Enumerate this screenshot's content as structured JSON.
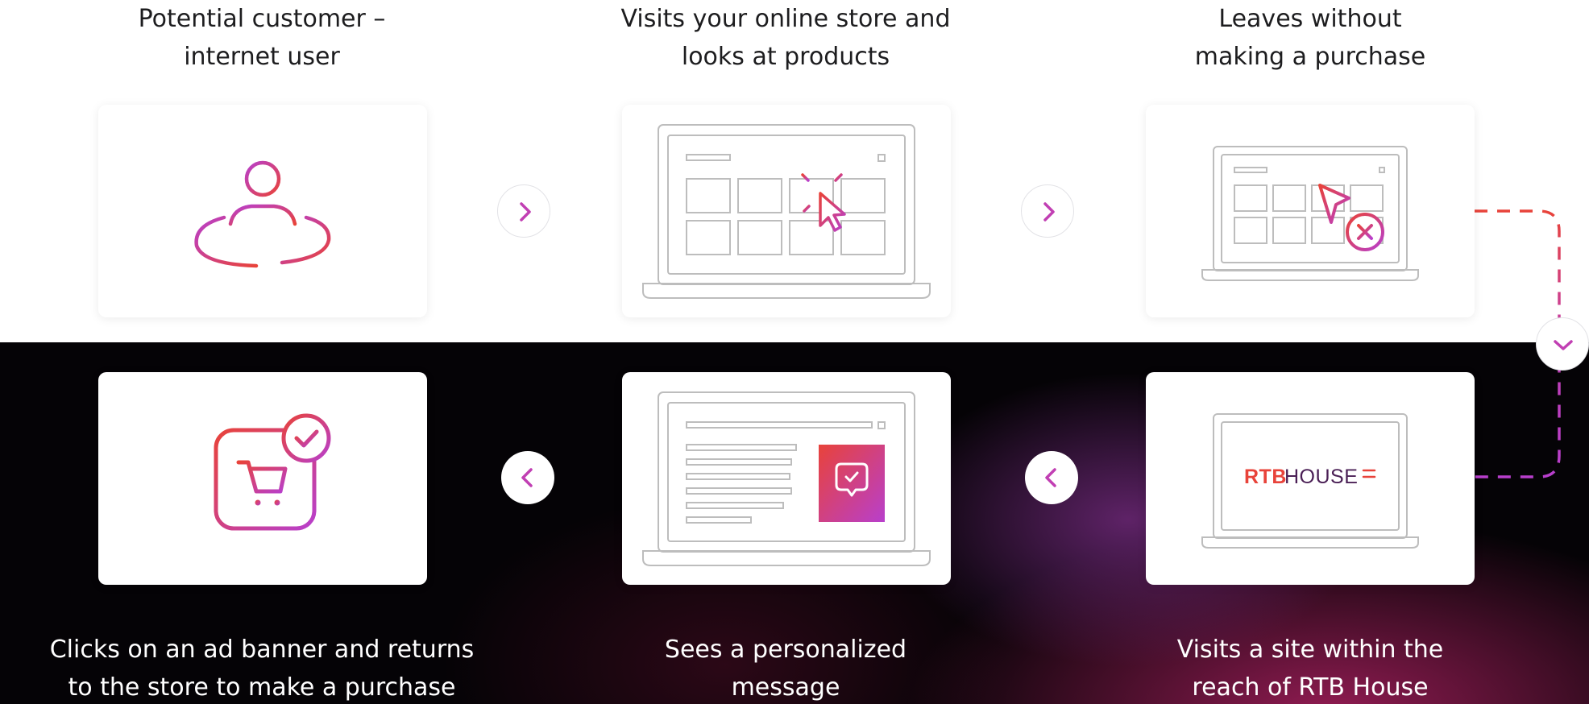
{
  "steps_top": [
    {
      "line1": "Potential customer –",
      "line2": "internet user",
      "icon": "user-icon"
    },
    {
      "line1": "Visits your online store and",
      "line2": "looks at products",
      "icon": "laptop-store-icon"
    },
    {
      "line1": "Leaves without",
      "line2": "making a purchase",
      "icon": "laptop-leave-icon"
    }
  ],
  "steps_bottom": [
    {
      "line1": "Clicks on an ad banner and returns",
      "line2": "to the store to make a purchase",
      "icon": "cart-check-icon"
    },
    {
      "line1": "Sees a personalized",
      "line2": "message",
      "icon": "laptop-message-icon"
    },
    {
      "line1": "Visits a site within the",
      "line2": "reach of RTB House",
      "icon": "laptop-rtb-icon"
    }
  ],
  "logo": {
    "rtb": "RTB",
    "house": "HOUSE"
  },
  "colors": {
    "accent_red": "#e8433a",
    "accent_magenta": "#c13fb3",
    "accent_purple": "#9b3fd0",
    "outline_gray": "#bdbdbd"
  }
}
